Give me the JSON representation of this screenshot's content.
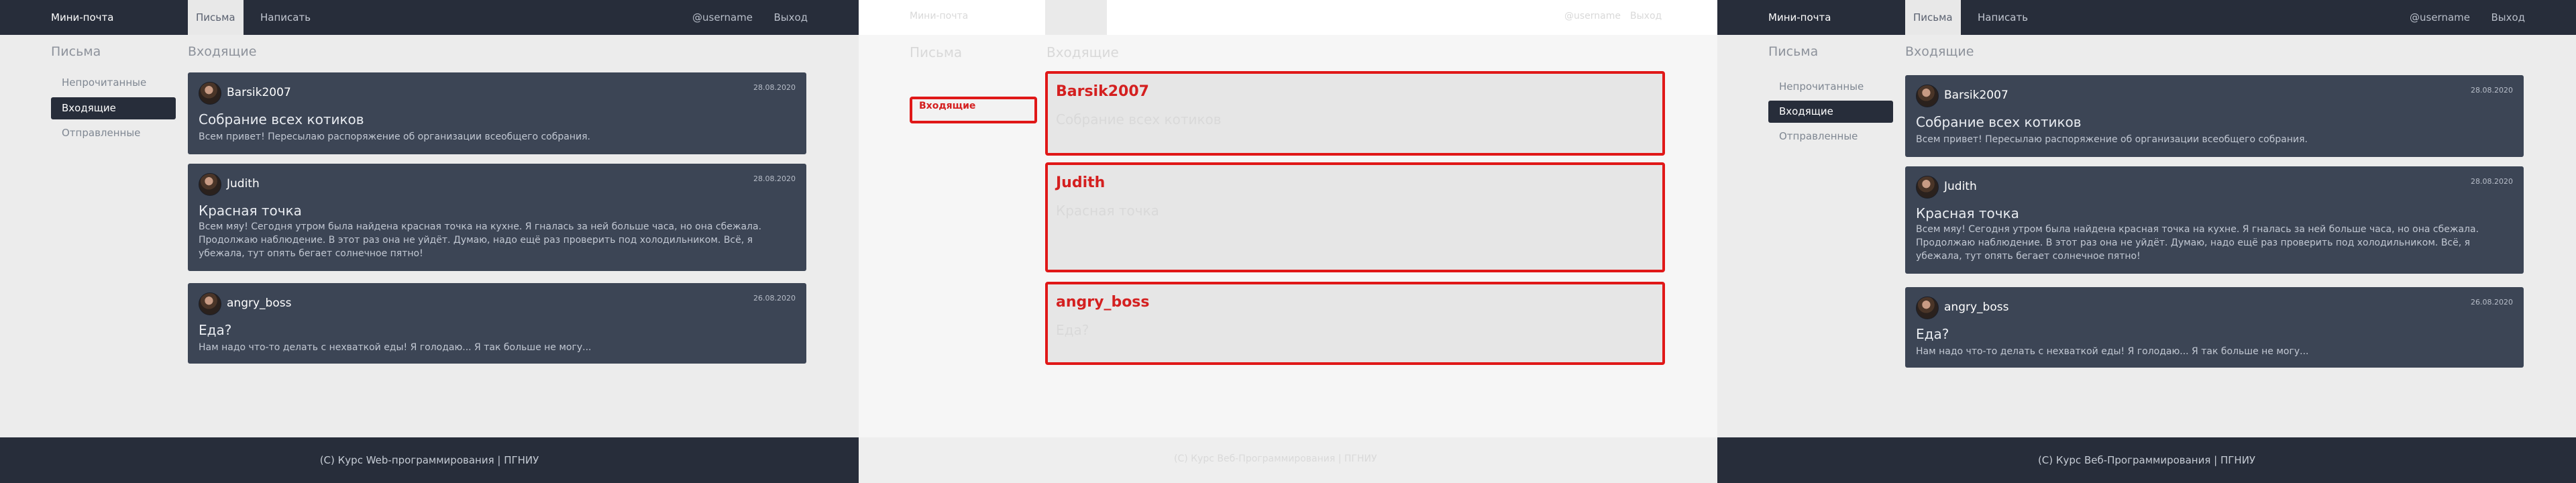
{
  "app": {
    "brand": "Мини-почта",
    "tabs": [
      "Письма",
      "Написать"
    ],
    "user": "@username",
    "logout": "Выход"
  },
  "sidebar": {
    "title": "Письма",
    "items": [
      "Непрочитанные",
      "Входящие",
      "Отправленные"
    ]
  },
  "main": {
    "title": "Входящие",
    "messages": [
      {
        "sender": "Barsik2007",
        "date": "28.08.2020",
        "subject": "Собрание всех котиков",
        "body": "Всем привет! Пересылаю распоряжение об организации всеобщего собрания."
      },
      {
        "sender": "Judith",
        "date": "28.08.2020",
        "subject": "Красная точка",
        "body": "Всем мяу! Сегодня утром была найдена красная точка на кухне. Я гналась за ней больше часа, но она сбежала. Продолжаю наблюдение. В этот раз она не уйдёт. Думаю, надо ещё раз проверить под холодильником. Всё, я убежала, тут опять бегает солнечное пятно!"
      },
      {
        "sender": "angry_boss",
        "date": "26.08.2020",
        "subject": "Еда?",
        "body": "Нам надо что-то делать с нехваткой еды! Я голодаю... Я так больше не могу..."
      }
    ]
  },
  "footer": {
    "left": "(C) Курс Web-программирования | ПГНИУ",
    "right": "(C) Курс Веб-Программирования | ПГНИУ"
  },
  "colors": {
    "navbar": "#272d3a",
    "card": "#3c4555",
    "diff_border": "#e01818"
  }
}
